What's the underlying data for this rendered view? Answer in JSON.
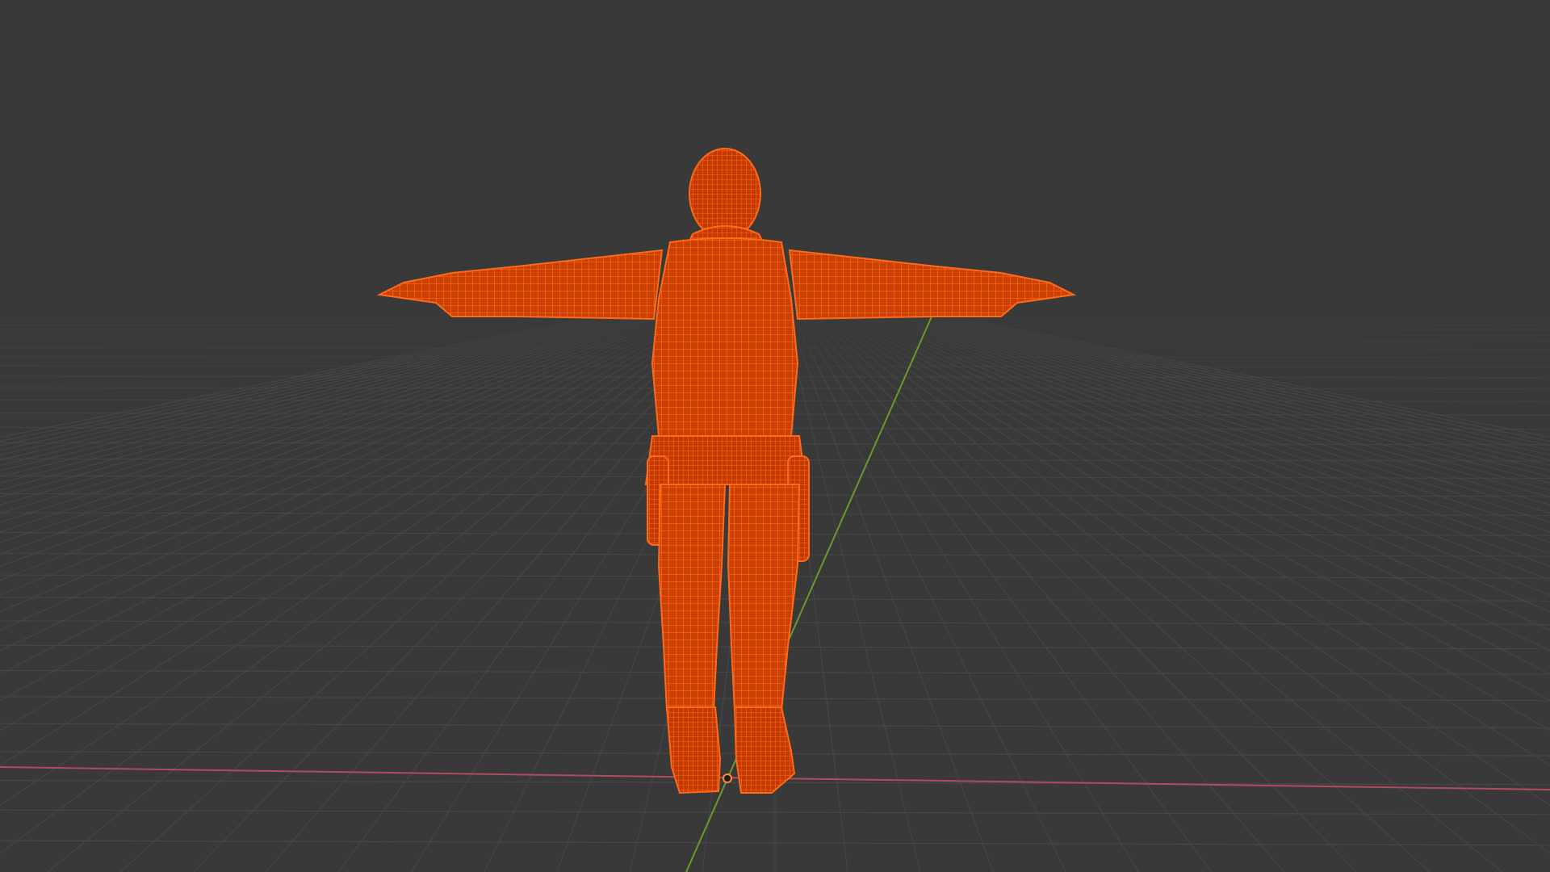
{
  "viewport": {
    "mode": "wireframe",
    "background": "#393939",
    "grid_color": "#4c4c4c",
    "x_axis_color": "#b34a5e",
    "y_axis_color": "#6a9a2a"
  },
  "object": {
    "type": "humanoid-mesh",
    "pose": "t-pose",
    "selected": true,
    "wire_color": "#ff5a0a",
    "fill_color": "#c43c00"
  },
  "origin": {
    "marker": "object-origin",
    "color": "#ff8a3a"
  }
}
